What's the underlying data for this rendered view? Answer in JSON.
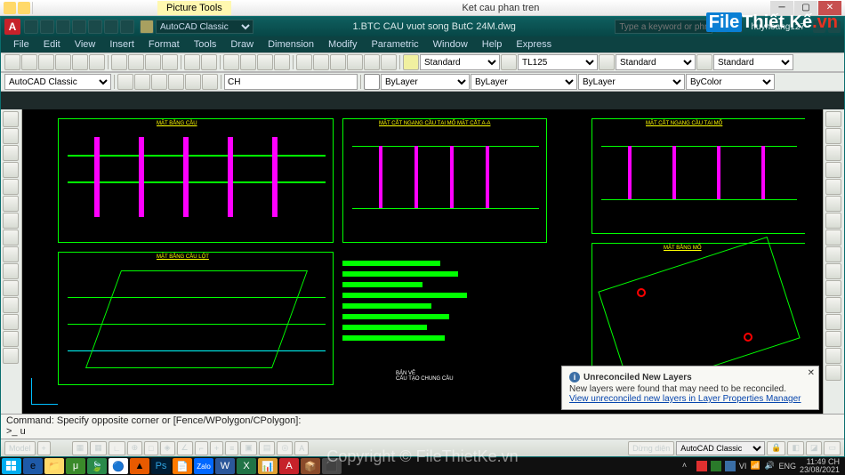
{
  "explorer": {
    "picture_tools_tab": "Picture Tools",
    "window_title": "Ket cau phan tren"
  },
  "acad": {
    "logo": "A",
    "workspace": "AutoCAD Classic",
    "document_title": "1.BTC CAU vuot song ButC 24M.dwg",
    "search_placeholder": "Type a keyword or phrase",
    "user": "huyhoang127"
  },
  "menu": [
    "File",
    "Edit",
    "View",
    "Insert",
    "Format",
    "Tools",
    "Draw",
    "Dimension",
    "Modify",
    "Parametric",
    "Window",
    "Help",
    "Express"
  ],
  "props": {
    "layer_control": "AutoCAD Classic",
    "cmd_input": "CH",
    "text_style": "Standard",
    "dim_style": "TL125",
    "table_style": "Standard",
    "mleader_style": "Standard",
    "color": "ByLayer",
    "lineweight": "ByLayer",
    "linetype": "ByLayer",
    "plot_style": "ByColor"
  },
  "drawing_labels": {
    "t1": "MẶT CẮT NGANG CẦU TẠI MỐ MẶT CẮT A-A",
    "t2": "MẶT BẰNG CẦU LỘT",
    "t3": "MẶT BẰNG MỐ",
    "t4": "MẶT CẮT NGANG CẦU TẠI MỐ",
    "t5": "BẢN VẼ",
    "t6": "CẤU TẠO CHUNG CẦU"
  },
  "notification": {
    "title": "Unreconciled New Layers",
    "body": "New layers were found that may need to be reconciled.",
    "link": "View unreconciled new layers in Layer Properties Manager"
  },
  "command": {
    "line1": "Command: Specify opposite corner or [Fence/WPolygon/CPolygon]:",
    "line2": ">_ u"
  },
  "statusbar": {
    "model_tab": "Model",
    "layout_plus": "+",
    "active_ann": "Dừng diện",
    "workspace": "AutoCAD Classic"
  },
  "tray": {
    "lang1": "VI",
    "lang2": "ENG",
    "time": "11:49 CH",
    "date": "23/08/2021"
  },
  "watermark": {
    "copyright": "Copyright © FileThietKe.vn",
    "logo_a": "File",
    "logo_b": "Thiết Kế",
    "logo_c": ".vn"
  }
}
